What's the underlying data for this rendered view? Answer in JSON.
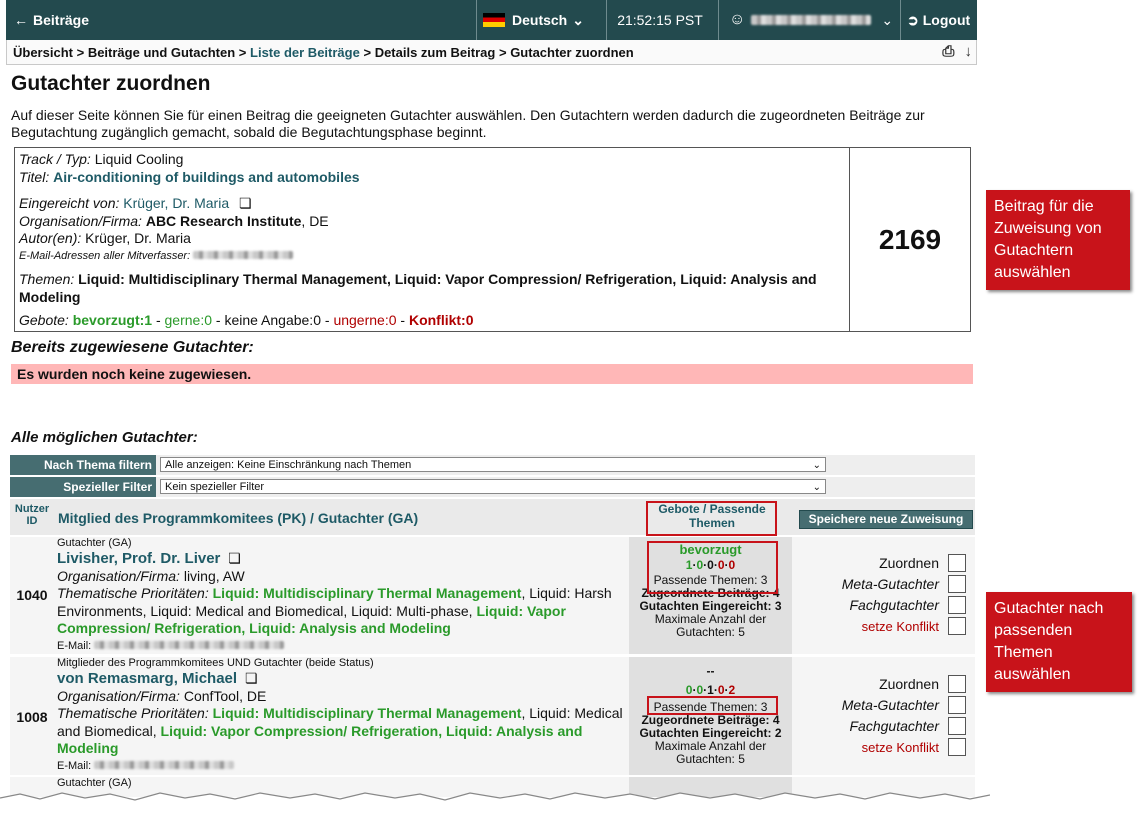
{
  "topbar": {
    "back_label": "Beiträge",
    "language": "Deutsch",
    "time": "21:52:15 PST",
    "logout_label": "Logout"
  },
  "breadcrumb": {
    "items": [
      "Übersicht",
      "Beiträge und Gutachten",
      "Liste der Beiträge",
      "Details zum Beitrag",
      "Gutachter zuordnen"
    ],
    "separator": ">"
  },
  "page": {
    "title": "Gutachter zuordnen",
    "intro": "Auf dieser Seite können Sie für einen Beitrag die geeigneten Gutachter auswählen. Den Gutachtern werden dadurch die zugeordneten Beiträge zur Begutachtung zugänglich gemacht, sobald die Begutachtungsphase beginnt."
  },
  "paper": {
    "track_label": "Track / Typ:",
    "track": "Liquid Cooling",
    "title_label": "Titel:",
    "title": "Air-conditioning of buildings and automobiles",
    "submitted_label": "Eingereicht von:",
    "submitted_by": "Krüger, Dr. Maria",
    "org_label": "Organisation/Firma:",
    "org_name": "ABC Research Institute",
    "org_country": ", DE",
    "authors_label": "Autor(en):",
    "authors": "Krüger, Dr. Maria",
    "emails_label": "E-Mail-Adressen aller Mitverfasser:",
    "topics_label": "Themen:",
    "topics": "Liquid: Multidisciplinary Thermal Management, Liquid: Vapor Compression/ Refrigeration, Liquid: Analysis and Modeling",
    "bids_label": "Gebote:",
    "bid_preferred": "bevorzugt:1",
    "bid_gladly": "gerne:0",
    "bid_none": "keine Angabe:0",
    "bid_reluctant": "ungerne:0",
    "bid_conflict": "Konflikt:0",
    "id": "2169"
  },
  "callouts": {
    "paper": "Beitrag für die Zuweisung von Gutachtern auswählen",
    "reviewers": "Gutachter nach passenden Themen auswählen"
  },
  "assigned": {
    "heading": "Bereits zugewiesene Gutachter:",
    "empty": "Es wurden noch keine zugewiesen."
  },
  "possible": {
    "heading": "Alle möglichen Gutachter:",
    "filter_topic_label": "Nach Thema filtern",
    "filter_topic_value": "Alle anzeigen: Keine Einschränkung nach Themen",
    "filter_special_label": "Spezieller Filter",
    "filter_special_value": "Kein spezieller Filter"
  },
  "table": {
    "col_id": "Nutzer ID",
    "col_member": "Mitglied des Programmkomitees (PK) / Gutachter (GA)",
    "col_bids": "Gebote / Passende Themen",
    "save_button": "Speichere neue Zuweisung",
    "opt_assign": "Zuordnen",
    "opt_meta": "Meta-Gutachter",
    "opt_expert": "Fachgutachter",
    "opt_conflict": "setze Konflikt",
    "org_label": "Organisation/Firma:",
    "prio_label": "Thematische Prioritäten:",
    "email_label": "E-Mail:",
    "assigned_label": "Zugeordnete Beiträge:",
    "submitted_label": "Gutachten Eingereicht:",
    "max_label": "Maximale Anzahl der Gutachten:",
    "rows": [
      {
        "id": "1040",
        "role": "Gutachter (GA)",
        "name": "Livisher, Prof. Dr. Liver",
        "org": "living, AW",
        "prio_1": "Liquid: Multidisciplinary Thermal Management",
        "prio_2": ", Liquid: Harsh Environments, Liquid: Medical and Biomedical, Liquid: Multi-phase, ",
        "prio_3": "Liquid: Vapor Compression/ Refrigeration, Liquid: Analysis and Modeling",
        "bid": "bevorzugt",
        "bid_counts": [
          "1",
          "0",
          "0",
          "0",
          "0"
        ],
        "matching_topics": "Passende Themen: 3",
        "assigned": "4",
        "submitted": "3",
        "max": "5"
      },
      {
        "id": "1008",
        "role": "Mitglieder des Programmkomitees UND Gutachter (beide Status)",
        "name": "von Remasmarg, Michael",
        "org": "ConfTool, DE",
        "prio_1": "Liquid: Multidisciplinary Thermal Management",
        "prio_2": ", Liquid: Medical and Biomedical, ",
        "prio_3": "Liquid: Vapor Compression/ Refrigeration, Liquid: Analysis and Modeling",
        "bid": "--",
        "bid_counts": [
          "0",
          "0",
          "1",
          "0",
          "2"
        ],
        "matching_topics": "Passende Themen: 3",
        "assigned": "4",
        "submitted": "2",
        "max": "5"
      },
      {
        "role": "Gutachter (GA)"
      }
    ]
  }
}
